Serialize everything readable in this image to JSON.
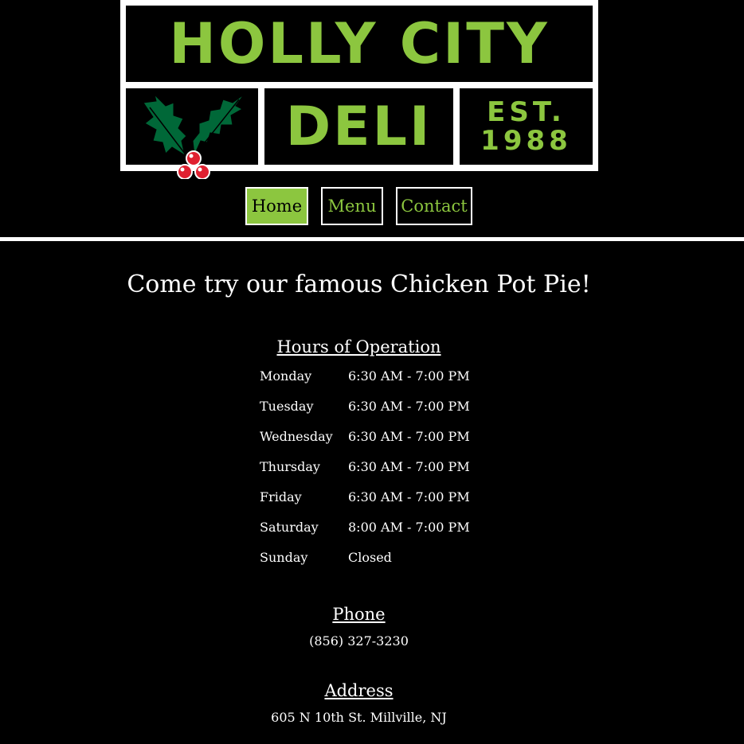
{
  "logo": {
    "line1": "HOLLY CITY",
    "line2": "DELI",
    "est_label": "EST.",
    "est_year": "1988",
    "icon": "holly-icon"
  },
  "nav": {
    "items": [
      {
        "label": "Home",
        "active": true
      },
      {
        "label": "Menu",
        "active": false
      },
      {
        "label": "Contact",
        "active": false
      }
    ]
  },
  "main": {
    "tagline": "Come try our famous Chicken Pot Pie!",
    "hours": {
      "heading": "Hours of Operation",
      "rows": [
        {
          "day": "Monday",
          "time": "6:30 AM - 7:00 PM"
        },
        {
          "day": "Tuesday",
          "time": "6:30 AM - 7:00 PM"
        },
        {
          "day": "Wednesday",
          "time": "6:30 AM - 7:00 PM"
        },
        {
          "day": "Thursday",
          "time": "6:30 AM - 7:00 PM"
        },
        {
          "day": "Friday",
          "time": "6:30 AM - 7:00 PM"
        },
        {
          "day": "Saturday",
          "time": "8:00 AM - 7:00 PM"
        },
        {
          "day": "Sunday",
          "time": "Closed"
        }
      ]
    },
    "phone": {
      "heading": "Phone",
      "value": "(856) 327-3230"
    },
    "address": {
      "heading": "Address",
      "value": "605 N 10th St. Millville, NJ"
    }
  },
  "colors": {
    "background": "#000000",
    "accent": "#8cc63f",
    "text": "#ffffff",
    "holly_leaf": "#006838",
    "berry": "#e02030"
  }
}
